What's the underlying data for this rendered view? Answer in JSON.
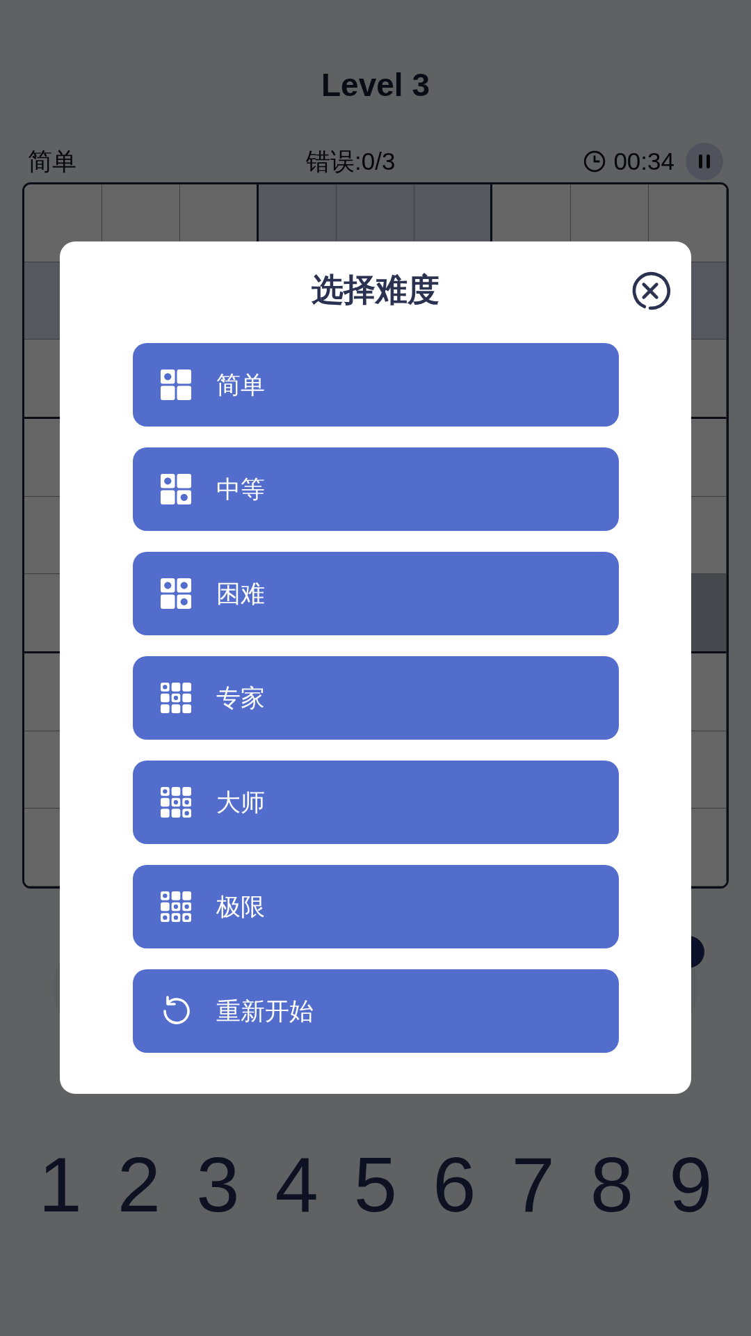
{
  "title": "Level 3",
  "status": {
    "difficulty": "简单",
    "mistakes": "错误:0/3",
    "timer": "00:34"
  },
  "grid": {
    "rows": [
      [
        {
          "highlighted": false,
          "selected": false
        },
        {
          "highlighted": false,
          "selected": false
        },
        {
          "highlighted": false,
          "selected": false
        },
        {
          "highlighted": true,
          "selected": false
        },
        {
          "highlighted": true,
          "selected": false
        },
        {
          "highlighted": true,
          "selected": false
        },
        {
          "highlighted": false,
          "selected": false
        },
        {
          "highlighted": false,
          "selected": false
        },
        {
          "highlighted": false,
          "selected": false
        }
      ],
      [
        {
          "highlighted": true,
          "selected": false
        },
        {},
        {},
        {},
        {},
        {},
        {},
        {},
        {
          "highlighted": true,
          "selected": false
        }
      ],
      [
        {
          "highlighted": false,
          "selected": false
        },
        {},
        {},
        {},
        {},
        {},
        {},
        {},
        {
          "highlighted": false,
          "selected": false
        }
      ],
      [
        {
          "highlighted": false,
          "selected": false
        },
        {},
        {},
        {},
        {},
        {},
        {},
        {},
        {
          "highlighted": false,
          "selected": false
        }
      ],
      [
        {
          "highlighted": false,
          "selected": false
        },
        {},
        {},
        {},
        {},
        {},
        {},
        {},
        {
          "highlighted": false,
          "selected": false
        }
      ],
      [
        {
          "highlighted": false,
          "selected": false
        },
        {},
        {},
        {},
        {},
        {},
        {},
        {},
        {
          "highlighted": true,
          "selected": true
        }
      ],
      [
        {
          "highlighted": false,
          "selected": false
        },
        {},
        {},
        {},
        {},
        {},
        {},
        {},
        {
          "highlighted": false,
          "selected": false
        }
      ],
      [
        {
          "highlighted": false,
          "selected": false
        },
        {},
        {},
        {},
        {},
        {},
        {},
        {},
        {
          "highlighted": false,
          "selected": false
        }
      ],
      [
        {
          "highlighted": false,
          "selected": false
        },
        {},
        {},
        {},
        {},
        {},
        {},
        {},
        {
          "highlighted": false,
          "selected": false
        }
      ]
    ]
  },
  "tools": [
    {
      "kind": "tool"
    },
    {
      "kind": "tool-badge"
    }
  ],
  "number_pad": [
    "1",
    "2",
    "3",
    "4",
    "5",
    "6",
    "7",
    "8",
    "9"
  ],
  "dialog": {
    "title": "选择难度",
    "options": [
      {
        "kind": "level",
        "label": "简单"
      },
      {
        "kind": "level",
        "label": "中等"
      },
      {
        "kind": "level",
        "label": "困难"
      },
      {
        "kind": "level",
        "label": "专家"
      },
      {
        "kind": "level",
        "label": "大师"
      },
      {
        "kind": "level",
        "label": "极限"
      },
      {
        "kind": "restart",
        "label": "重新开始"
      }
    ]
  }
}
